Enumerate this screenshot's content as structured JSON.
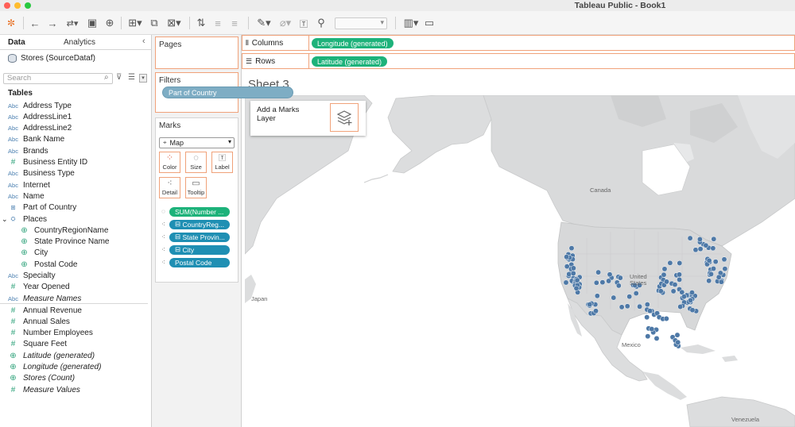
{
  "window": {
    "title": "Tableau Public - Book1"
  },
  "left_pane": {
    "tabs": {
      "data": "Data",
      "analytics": "Analytics"
    },
    "datasource": "Stores (SourceDataf)",
    "search_placeholder": "Search",
    "tables_heading": "Tables",
    "fields": [
      {
        "type": "Abc",
        "name": "Address Type"
      },
      {
        "type": "Abc",
        "name": "AddressLine1"
      },
      {
        "type": "Abc",
        "name": "AddressLine2"
      },
      {
        "type": "Abc",
        "name": "Bank Name"
      },
      {
        "type": "Abc",
        "name": "Brands"
      },
      {
        "type": "#",
        "name": "Business Entity ID"
      },
      {
        "type": "Abc",
        "name": "Business Type"
      },
      {
        "type": "Abc",
        "name": "Internet"
      },
      {
        "type": "Abc",
        "name": "Name"
      },
      {
        "type": "group",
        "name": "Part of Country"
      },
      {
        "type": "hierarchy",
        "name": "Places"
      },
      {
        "type": "geo",
        "name": "CountryRegionName"
      },
      {
        "type": "geo",
        "name": "State Province Name"
      },
      {
        "type": "geo",
        "name": "City"
      },
      {
        "type": "geo",
        "name": "Postal Code"
      },
      {
        "type": "Abc",
        "name": "Specialty"
      },
      {
        "type": "#",
        "name": "Year Opened"
      },
      {
        "type": "Abc",
        "name": "Measure Names"
      }
    ],
    "measures": [
      {
        "type": "#",
        "name": "Annual Revenue"
      },
      {
        "type": "#",
        "name": "Annual Sales"
      },
      {
        "type": "#",
        "name": "Number Employees"
      },
      {
        "type": "#",
        "name": "Square Feet"
      },
      {
        "type": "geo",
        "name": "Latitude (generated)"
      },
      {
        "type": "geo",
        "name": "Longitude (generated)"
      },
      {
        "type": "geo",
        "name": "Stores (Count)"
      },
      {
        "type": "#",
        "name": "Measure Values"
      }
    ]
  },
  "cards": {
    "pages": "Pages",
    "filters": "Filters",
    "marks": "Marks",
    "mark_type": "Map",
    "mark_buttons": {
      "color": "Color",
      "size": "Size",
      "label": "Label",
      "detail": "Detail",
      "tooltip": "Tooltip"
    },
    "mark_pills": [
      "SUM(Number ...",
      "CountryReg...",
      "State Provin...",
      "City",
      "Postal Code"
    ]
  },
  "shelves": {
    "columns_label": "Columns",
    "columns_pill": "Longitude (generated)",
    "rows_label": "Rows",
    "rows_pill": "Latitude (generated)"
  },
  "view": {
    "sheet_title": "Sheet 3",
    "dragged_pill": "Part of Country",
    "marks_layer_text": "Add a Marks Layer",
    "map_labels": {
      "canada": "Canada",
      "united_states": "United States",
      "mexico": "Mexico",
      "japan": "Japan",
      "venezuela": "Venezuela"
    }
  },
  "colors": {
    "pill_green": "#1db27a",
    "pill_blue": "#1f8fb3",
    "shelf_border": "#f0a27a",
    "map_land": "#d9dadb",
    "map_point": "#4e79a7"
  }
}
